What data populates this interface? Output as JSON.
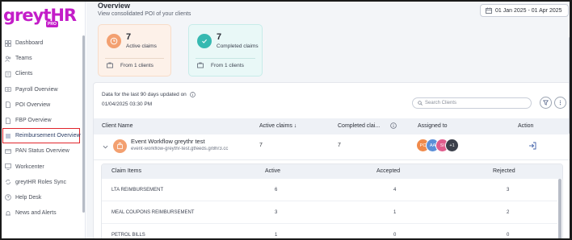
{
  "brand": {
    "logo": "greytHR",
    "badge": "PRO"
  },
  "sidebar": {
    "items": [
      {
        "label": "Dashboard",
        "icon": "dashboard-icon"
      },
      {
        "label": "Teams",
        "icon": "teams-icon"
      },
      {
        "label": "Clients",
        "icon": "clients-icon"
      },
      {
        "label": "Payroll Overview",
        "icon": "payroll-icon"
      },
      {
        "label": "POI Overview",
        "icon": "document-icon"
      },
      {
        "label": "FBP Overview",
        "icon": "document-icon"
      },
      {
        "label": "Reimbursement Overview",
        "icon": "list-icon",
        "active": true
      },
      {
        "label": "PAN Status Overview",
        "icon": "card-icon"
      },
      {
        "label": "Workcenter",
        "icon": "monitor-icon"
      },
      {
        "label": "greytHR Roles Sync",
        "icon": "sync-icon"
      },
      {
        "label": "Help Desk",
        "icon": "help-icon"
      },
      {
        "label": "News and Alerts",
        "icon": "bell-icon"
      }
    ]
  },
  "header": {
    "title": "Overview",
    "subtitle": "View consolidated POI of your clients",
    "date_range": "01 Jan 2025 - 01 Apr 2025"
  },
  "cards": {
    "active": {
      "count": "7",
      "label": "Active claims",
      "from": "From 1 clients"
    },
    "completed": {
      "count": "7",
      "label": "Completed claims",
      "from": "From 1 clients"
    }
  },
  "panel": {
    "meta_line1": "Data for the last 90 days updated on",
    "meta_line2": "01/04/2025 03:30 PM",
    "search_placeholder": "Search Clients",
    "columns": {
      "client_name": "Client Name",
      "active_claims": "Active claims ↓",
      "completed_claims": "Completed clai...",
      "assigned_to": "Assigned to",
      "action": "Action"
    },
    "client": {
      "name": "Event Workflow greythr test",
      "slug": "event-workflow-greythr-test.gtfeeds.gr8hr3.cc",
      "active": "7",
      "completed": "7",
      "avatars": [
        "PC",
        "AA",
        "SI"
      ],
      "more": "+1"
    },
    "claims": {
      "columns": {
        "item": "Claim Items",
        "active": "Active",
        "accepted": "Accepted",
        "rejected": "Rejected"
      },
      "rows": [
        {
          "item": "LTA REIMBURSEMENT",
          "active": "6",
          "accepted": "4",
          "rejected": "3"
        },
        {
          "item": "MEAL COUPONS REIMBURSEMENT",
          "active": "3",
          "accepted": "1",
          "rejected": "2"
        },
        {
          "item": "PETROL BILLS",
          "active": "1",
          "accepted": "0",
          "rejected": "0"
        }
      ]
    }
  },
  "colors": {
    "brand": "#c31dc8",
    "active_card": "#fdf1e9",
    "completed_card": "#e9f8f7",
    "highlight_border": "#e0242a"
  }
}
